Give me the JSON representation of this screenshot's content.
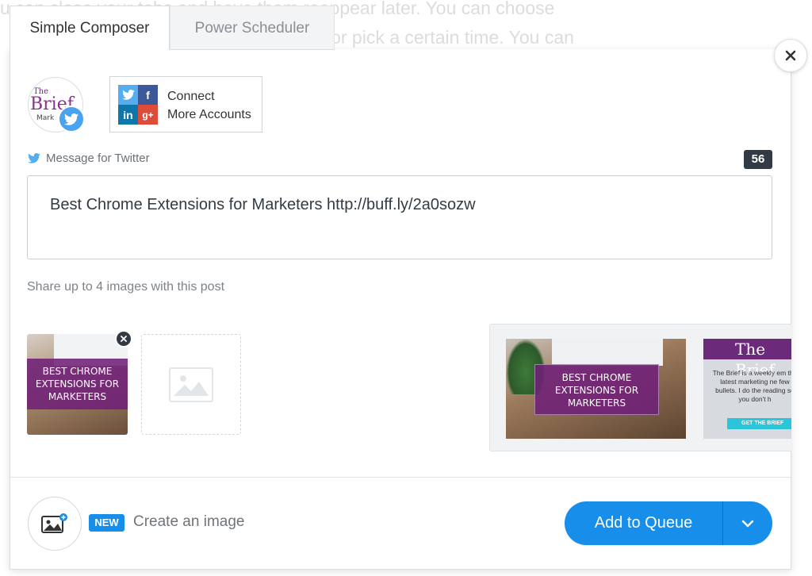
{
  "background": {
    "line1": "u can close your tabs and have them reappear later. You can choose",
    "line2": "ek, or pick a certain time. You can"
  },
  "tabs": [
    {
      "label": "Simple Composer",
      "active": true
    },
    {
      "label": "Power Scheduler",
      "active": false
    }
  ],
  "profile": {
    "avatar_text_top": "The",
    "avatar_text_main": "Brief",
    "avatar_text_sub": "Mark",
    "network_icon": "twitter-icon"
  },
  "connect": {
    "line1": "Connect",
    "line2": "More Accounts"
  },
  "composer": {
    "label": "Message for Twitter",
    "char_count": "56",
    "message": "Best Chrome Extensions for Marketers http://buff.ly/2a0sozw"
  },
  "images": {
    "share_label": "Share up to 4 images with this post",
    "attached_caption": "BEST CHROME EXTENSIONS FOR MARKETERS",
    "suggested": [
      {
        "caption": "BEST CHROME EXTENSIONS FOR MARKETERS"
      },
      {
        "heading": "The Brief",
        "body": "The Brief is a weekly em the latest marketing ne few bullets. I do the reading so you don't h",
        "button": "GET THE BRIEF"
      }
    ]
  },
  "footer": {
    "new_badge": "NEW",
    "create_label": "Create an image",
    "queue_label": "Add to Queue"
  },
  "colors": {
    "primary": "#168eea",
    "twitter": "#55acee",
    "counter_bg": "#323b43"
  }
}
